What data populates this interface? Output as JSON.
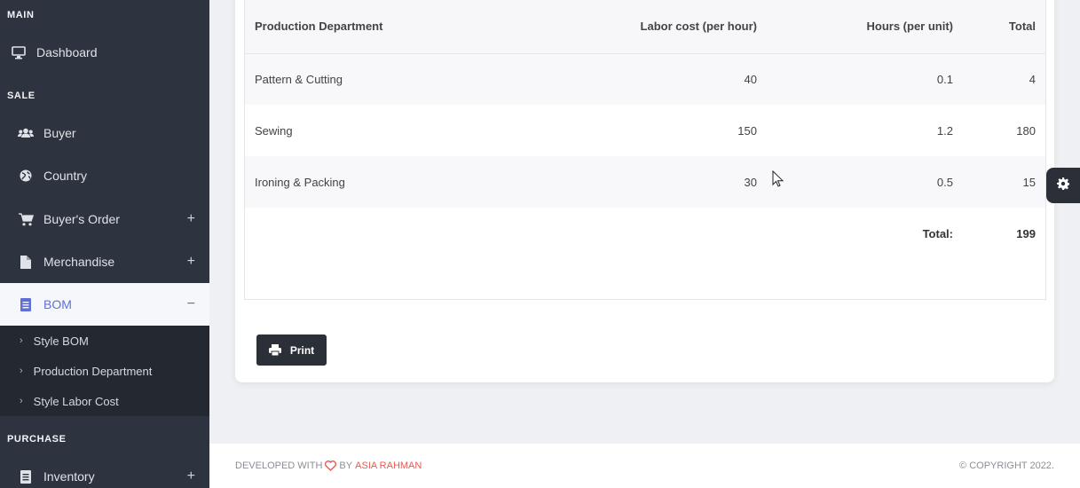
{
  "sidebar": {
    "sections": {
      "main": "MAIN",
      "sale": "SALE",
      "purchase": "PURCHASE"
    },
    "items": {
      "dashboard": "Dashboard",
      "buyer": "Buyer",
      "country": "Country",
      "buyers_order": "Buyer's Order",
      "merchandise": "Merchandise",
      "bom": "BOM",
      "inventory": "Inventory"
    },
    "toggles": {
      "plus": "+",
      "minus": "−"
    },
    "submenu": {
      "style_bom": "Style BOM",
      "production_department": "Production Department",
      "style_labor_cost": "Style Labor Cost"
    },
    "chevron": "›"
  },
  "table": {
    "headers": [
      "Production Department",
      "Labor cost (per hour)",
      "Hours (per unit)",
      "Total"
    ],
    "rows": [
      [
        "Pattern & Cutting",
        "40",
        "0.1",
        "4"
      ],
      [
        "Sewing",
        "150",
        "1.2",
        "180"
      ],
      [
        "Ironing & Packing",
        "30",
        "0.5",
        "15"
      ]
    ],
    "total_label": "Total:",
    "total_value": "199"
  },
  "print_label": "Print",
  "footer": {
    "developed_with": "DEVELOPED WITH",
    "by": "BY",
    "author": "ASIA RAHMAN",
    "copyright": "© COPYRIGHT 2022."
  },
  "colors": {
    "sidebar_bg": "#2d3440",
    "submenu_bg": "#232831",
    "active_text": "#5f6fd6",
    "button_bg": "#2a2f38",
    "accent_red": "#e85a4f"
  }
}
